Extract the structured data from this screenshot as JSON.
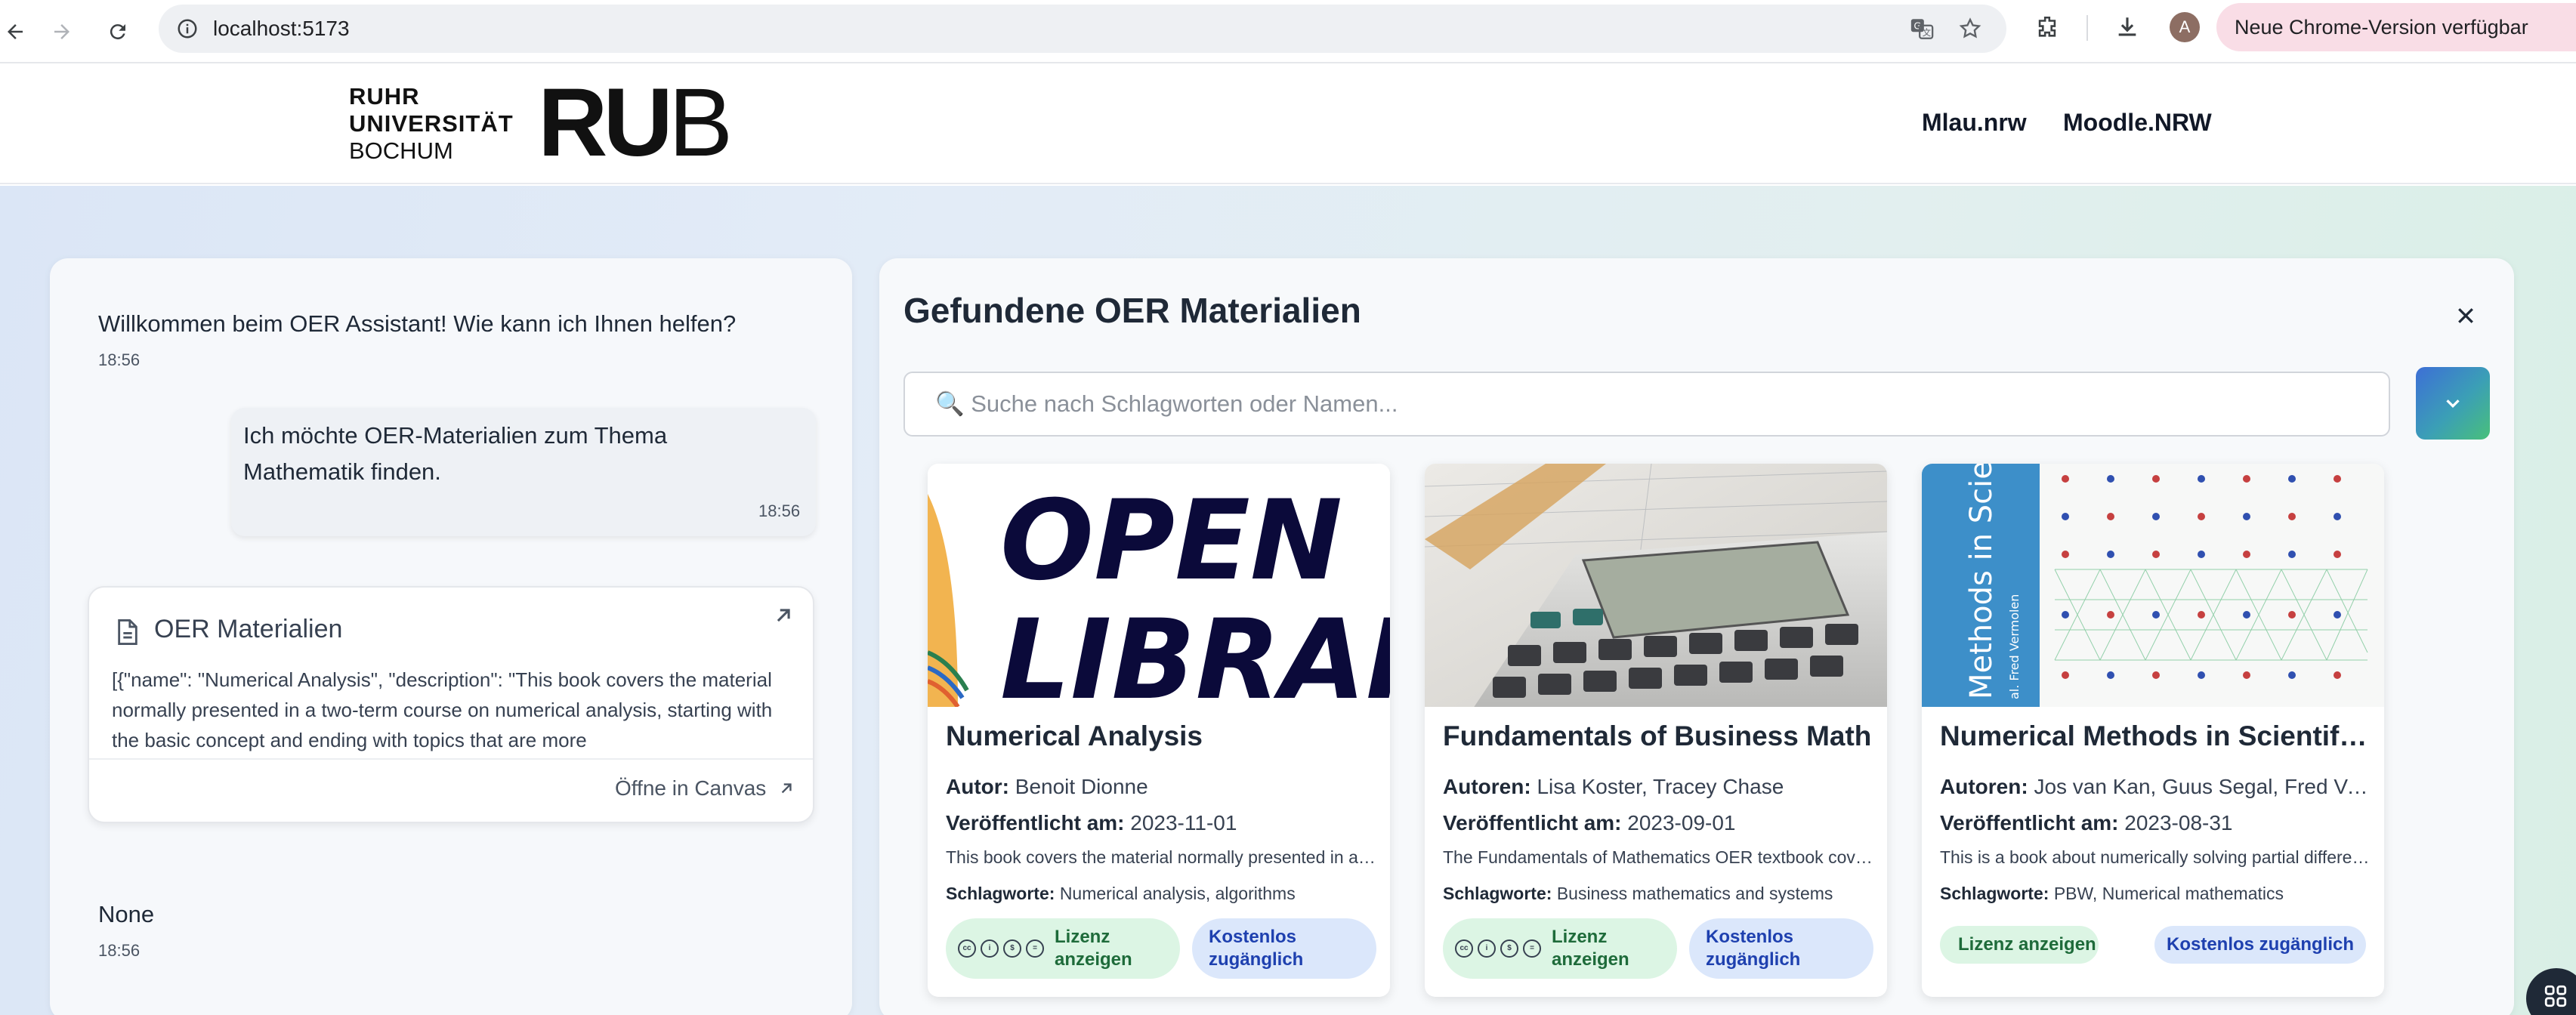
{
  "browser": {
    "url": "localhost:5173",
    "profile_initial": "A",
    "update_notice": "Neue Chrome-Version verfügbar"
  },
  "site": {
    "logo_lines": [
      "RUHR",
      "UNIVERSITÄT",
      "BOCHUM"
    ],
    "logo_mark_bold": "RU",
    "logo_mark_thin": "B",
    "nav": [
      "Mlau.nrw",
      "Moodle.NRW"
    ]
  },
  "chat": {
    "messages": [
      {
        "role": "assistant",
        "text": "Willkommen beim OER Assistant! Wie kann ich Ihnen helfen?",
        "time": "18:56"
      },
      {
        "role": "user",
        "text_line1": "Ich möchte OER-Materialien zum Thema",
        "text_line2": "Mathematik finden.",
        "time": "18:56"
      },
      {
        "role": "assistant",
        "text": "None",
        "time": "18:56"
      }
    ],
    "oer_card": {
      "title": "OER Materialien",
      "description": "[{\"name\": \"Numerical Analysis\", \"description\": \"This book covers the material normally presented in a two-term course on numerical analysis, starting with the basic concept and ending with topics that are more",
      "open_label": "Öffne in Canvas"
    }
  },
  "results": {
    "title": "Gefundene OER Materialien",
    "search_placeholder": "🔍 Suche nach Schlagworten oder Namen...",
    "published_label": "Veröffentlicht am:",
    "tags_label": "Schlagworte:",
    "license_label": "Lizenz anzeigen",
    "free_label": "Kostenlos zugänglich",
    "cards": [
      {
        "title": "Numerical Analysis",
        "author_label": "Autor:",
        "authors": "Benoit Dionne",
        "published": "2023-11-01",
        "description": "This book covers the material normally presented in a two-term course on numerical analysis",
        "tags": "Numerical analysis, algorithms",
        "thumb_text_1": "OPEN",
        "thumb_text_2": "LIBRARY"
      },
      {
        "title": "Fundamentals of Business Math",
        "author_label": "Autoren:",
        "authors": "Lisa Koster, Tracey Chase",
        "published": "2023-09-01",
        "description": "The Fundamentals of Mathematics OER textbook covers",
        "tags": "Business mathematics and systems"
      },
      {
        "title": "Numerical Methods in Scientific Computing",
        "author_label": "Autoren:",
        "authors": "Jos van Kan, Guus Segal, Fred Vermolen",
        "published": "2023-08-31",
        "description": "This is a book about numerically solving partial differential equations",
        "tags": "PBW, Numerical mathematics",
        "spine_text": "Methods in Scientific Co",
        "spine_sub": "al. Fred Vermolen"
      }
    ]
  }
}
